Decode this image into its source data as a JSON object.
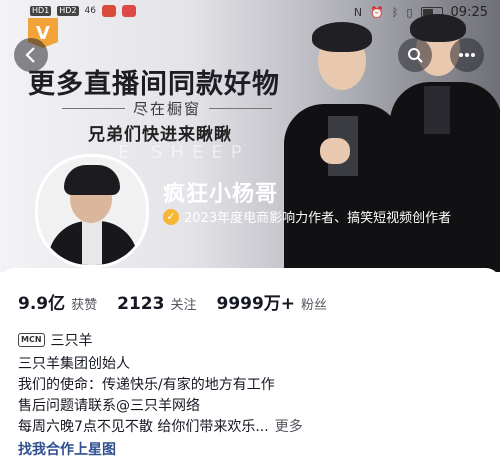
{
  "status_bar": {
    "left_tags": [
      "HD1",
      "HD2"
    ],
    "signal_text": "46",
    "time": "09:25"
  },
  "banner": {
    "logo_text": "V",
    "headline": "更多直播间同款好物",
    "subline": "尽在橱窗",
    "cta": "兄弟们快进来瞅瞅",
    "watermark": "E SHEEP"
  },
  "nav": {
    "back_icon": "chevron-left-icon",
    "search_icon": "search-icon",
    "more_icon": "more-dots-icon"
  },
  "profile": {
    "name": "疯狂小杨哥",
    "verification": "2023年度电商影响力作者、搞笑短视频创作者"
  },
  "stats": [
    {
      "value": "9.9亿",
      "label": "获赞"
    },
    {
      "value": "2123",
      "label": "关注"
    },
    {
      "value": "9999万+",
      "label": "粉丝"
    }
  ],
  "mcn": {
    "icon_text": "MCN",
    "name": "三只羊"
  },
  "bio": {
    "line1": "三只羊集团创始人",
    "line2": "我们的使命：传递快乐/有家的地方有工作",
    "line3_prefix": "售后问题请联系",
    "line3_mention": "@三只羊网络",
    "line4": "每周六晚7点不见不散  给你们带来欢乐...",
    "more": "更多"
  },
  "business_link": "找我合作上星图",
  "colors": {
    "verify_badge": "#f6b533",
    "link": "#2f4f8f",
    "logo": "#f2a33a"
  }
}
